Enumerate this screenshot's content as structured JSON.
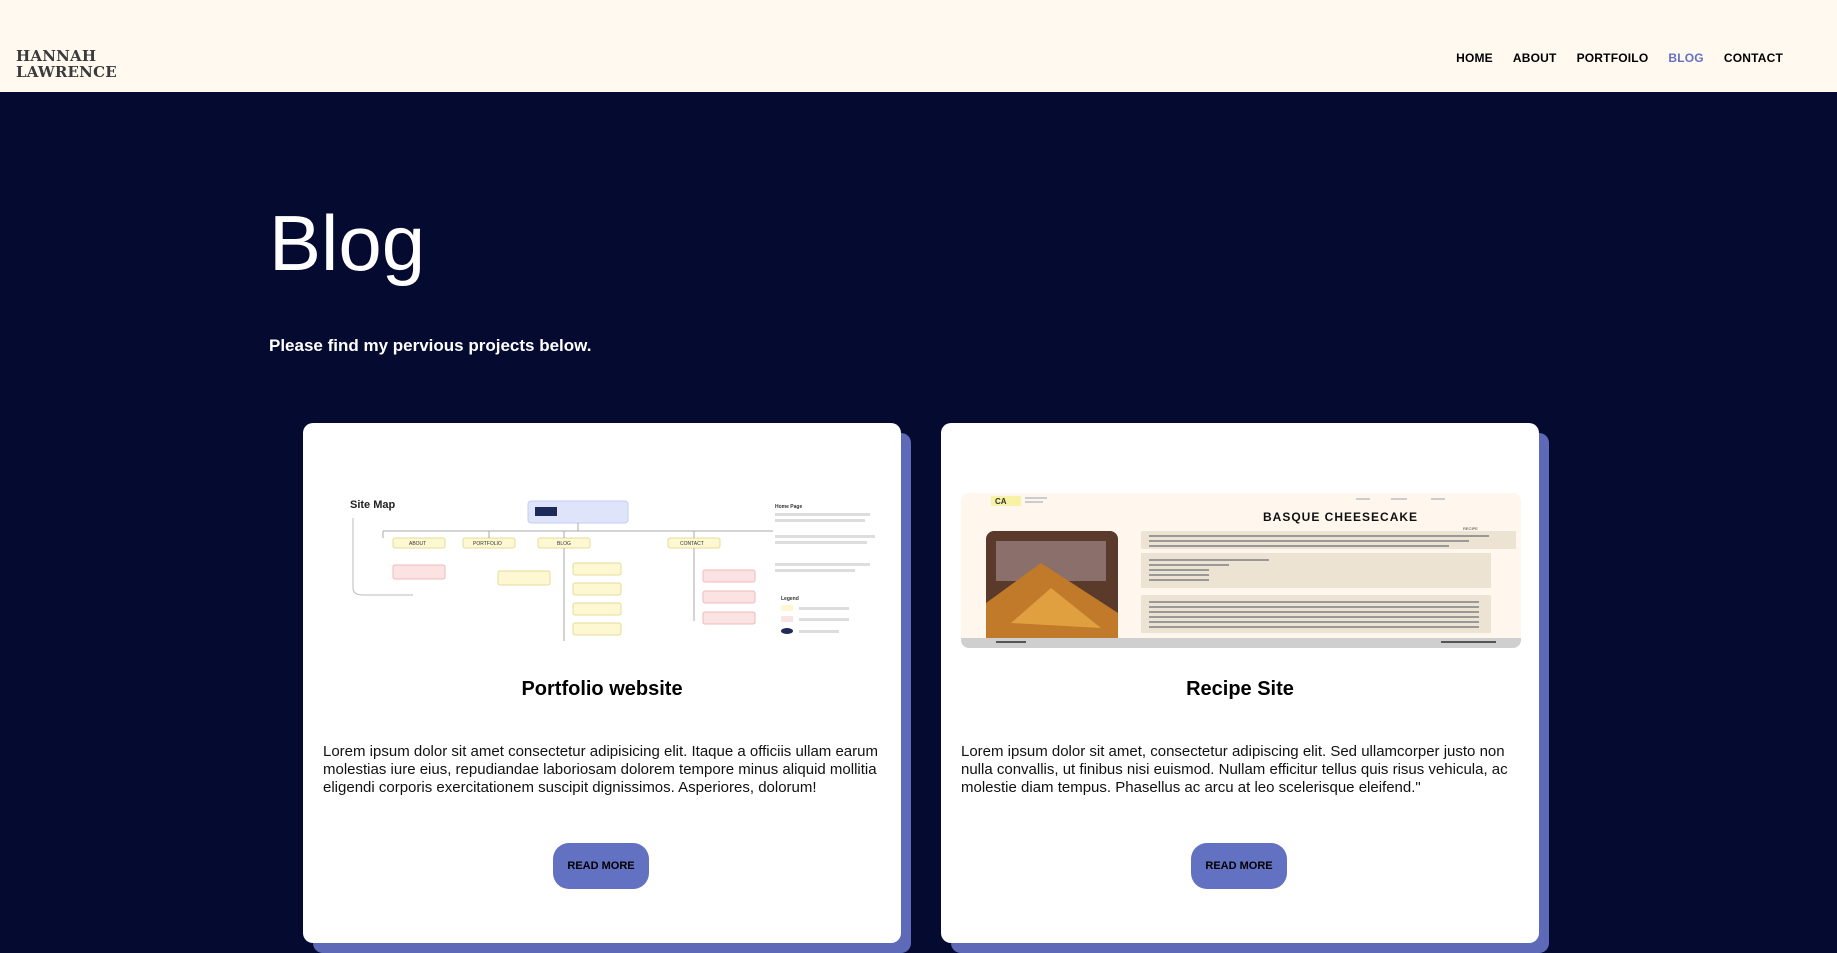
{
  "header": {
    "logo_line1": "HANNAH",
    "logo_line2": "LAWRENCE",
    "nav": [
      {
        "label": "HOME"
      },
      {
        "label": "ABOUT"
      },
      {
        "label": "PORTFOILO"
      },
      {
        "label": "BLOG",
        "active": true
      },
      {
        "label": "CONTACT"
      }
    ]
  },
  "main": {
    "title": "Blog",
    "subtitle": "Please find my pervious projects below."
  },
  "cards": [
    {
      "title": "Portfolio website",
      "text": "Lorem ipsum dolor sit amet consectetur adipisicing elit. Itaque a officiis ullam earum molestias iure eius, repudiandae laboriosam dolorem tempore minus aliquid mollitia eligendi corporis exercitationem suscipit dignissimos. Asperiores, dolorum!",
      "button": "READ MORE",
      "image": {
        "heading": "Site Map",
        "nodes": [
          "ABOUT",
          "PORTFOLIO",
          "BLOG",
          "CONTACT"
        ],
        "legend": "Legend",
        "side_heading": "Home Page"
      }
    },
    {
      "title": "Recipe Site",
      "text": "Lorem ipsum dolor sit amet, consectetur adipiscing elit. Sed ullamcorper justo non nulla convallis, ut finibus nisi euismod. Nullam efficitur tellus quis risus vehicula, ac molestie diam tempus. Phasellus ac arcu at leo scelerisque eleifend.\"",
      "button": "READ MORE",
      "image": {
        "brand": "CA",
        "heading": "BASQUE CHEESECAKE",
        "sub": "RECIPE"
      }
    }
  ],
  "colors": {
    "background": "#050a30",
    "header": "#fff9f0",
    "accent": "#6371c2"
  }
}
